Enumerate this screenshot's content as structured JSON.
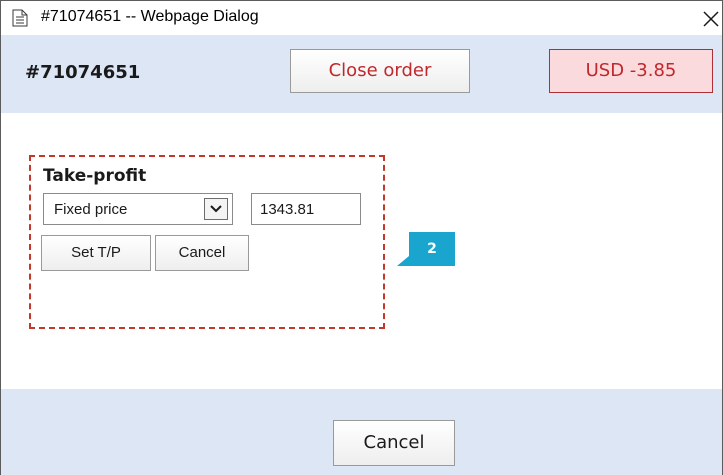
{
  "window": {
    "title": "#71074651 -- Webpage Dialog",
    "title_icon": "document-icon",
    "close_icon": "close-icon"
  },
  "header": {
    "order_id": "#71074651",
    "close_order_label": "Close order",
    "profit_badge": "USD -3.85"
  },
  "take_profit": {
    "title": "Take-profit",
    "mode_selected": "Fixed price",
    "price_value": "1343.81",
    "set_label": "Set T/P",
    "cancel_label": "Cancel"
  },
  "callout": {
    "number": "2"
  },
  "footer": {
    "cancel_label": "Cancel"
  },
  "colors": {
    "header_bg": "#dce6f4",
    "accent_red": "#c0282c",
    "badge_bg": "#fadadd",
    "callout_bg": "#1aa5cf",
    "dashed_border": "#c0392b"
  }
}
